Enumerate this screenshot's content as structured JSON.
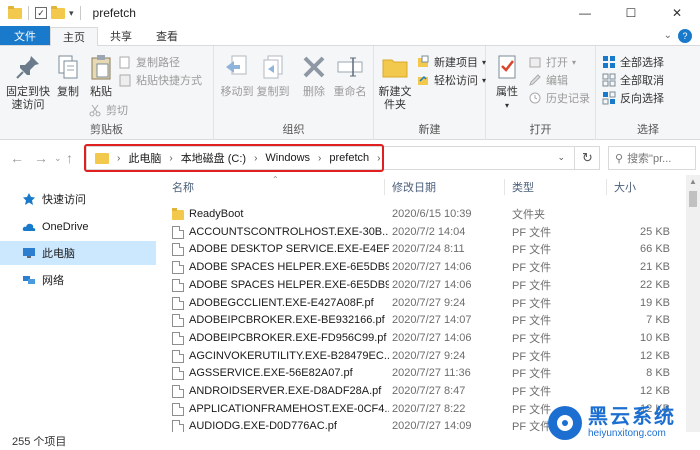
{
  "window": {
    "title": "prefetch",
    "min": "—",
    "max": "☐",
    "close": "✕"
  },
  "tabs": [
    "文件",
    "主页",
    "共享",
    "查看"
  ],
  "ribbon": {
    "clipboard": {
      "label": "剪贴板",
      "pin": "固定到快速访问",
      "copy": "复制",
      "paste": "粘贴",
      "copy_path": "复制路径",
      "paste_shortcut": "粘贴快捷方式",
      "cut": "剪切"
    },
    "organize": {
      "label": "组织",
      "move_to": "移动到",
      "copy_to": "复制到",
      "delete": "删除",
      "rename": "重命名"
    },
    "new": {
      "label": "新建",
      "new_folder": "新建文件夹",
      "new_item": "新建项目",
      "easy_access": "轻松访问"
    },
    "open": {
      "label": "打开",
      "properties": "属性",
      "open": "打开",
      "edit": "编辑",
      "history": "历史记录"
    },
    "select": {
      "label": "选择",
      "select_all": "全部选择",
      "select_none": "全部取消",
      "invert": "反向选择"
    }
  },
  "address": {
    "crumbs": [
      "此电脑",
      "本地磁盘 (C:)",
      "Windows",
      "prefetch"
    ],
    "search_placeholder": "搜索\"pr..."
  },
  "nav": {
    "items": [
      "快速访问",
      "OneDrive",
      "此电脑",
      "网络"
    ]
  },
  "columns": {
    "name": "名称",
    "date": "修改日期",
    "type": "类型",
    "size": "大小"
  },
  "files": [
    {
      "name": "ReadyBoot",
      "date": "2020/6/15 10:39",
      "type": "文件夹",
      "size": "",
      "kind": "folder"
    },
    {
      "name": "ACCOUNTSCONTROLHOST.EXE-30B...",
      "date": "2020/7/2 14:04",
      "type": "PF 文件",
      "size": "25 KB",
      "kind": "doc"
    },
    {
      "name": "ADOBE DESKTOP SERVICE.EXE-E4EF...",
      "date": "2020/7/24 8:11",
      "type": "PF 文件",
      "size": "66 KB",
      "kind": "doc"
    },
    {
      "name": "ADOBE SPACES HELPER.EXE-6E5DB9...",
      "date": "2020/7/27 14:06",
      "type": "PF 文件",
      "size": "21 KB",
      "kind": "doc"
    },
    {
      "name": "ADOBE SPACES HELPER.EXE-6E5DB9...",
      "date": "2020/7/27 14:06",
      "type": "PF 文件",
      "size": "22 KB",
      "kind": "doc"
    },
    {
      "name": "ADOBEGCCLIENT.EXE-E427A08F.pf",
      "date": "2020/7/27 9:24",
      "type": "PF 文件",
      "size": "19 KB",
      "kind": "doc"
    },
    {
      "name": "ADOBEIPCBROKER.EXE-BE932166.pf",
      "date": "2020/7/27 14:07",
      "type": "PF 文件",
      "size": "7 KB",
      "kind": "doc"
    },
    {
      "name": "ADOBEIPCBROKER.EXE-FD956C99.pf",
      "date": "2020/7/27 14:06",
      "type": "PF 文件",
      "size": "10 KB",
      "kind": "doc"
    },
    {
      "name": "AGCINVOKERUTILITY.EXE-B28479EC....",
      "date": "2020/7/27 9:24",
      "type": "PF 文件",
      "size": "12 KB",
      "kind": "doc"
    },
    {
      "name": "AGSSERVICE.EXE-56E82A07.pf",
      "date": "2020/7/27 11:36",
      "type": "PF 文件",
      "size": "8 KB",
      "kind": "doc"
    },
    {
      "name": "ANDROIDSERVER.EXE-D8ADF28A.pf",
      "date": "2020/7/27 8:47",
      "type": "PF 文件",
      "size": "12 KB",
      "kind": "doc"
    },
    {
      "name": "APPLICATIONFRAMEHOST.EXE-0CF4...",
      "date": "2020/7/27 8:22",
      "type": "PF 文件",
      "size": "12 KB",
      "kind": "doc"
    },
    {
      "name": "AUDIODG.EXE-D0D776AC.pf",
      "date": "2020/7/27 14:09",
      "type": "PF 文件",
      "size": "",
      "kind": "doc"
    }
  ],
  "status": {
    "count": "255 个项目"
  },
  "watermark": {
    "cn": "黑云系统",
    "en": "heiyunxitong.com"
  },
  "colors": {
    "accent": "#1979ca",
    "highlight": "#e02020",
    "selected": "#cce8ff",
    "folder": "#f2c94c"
  }
}
